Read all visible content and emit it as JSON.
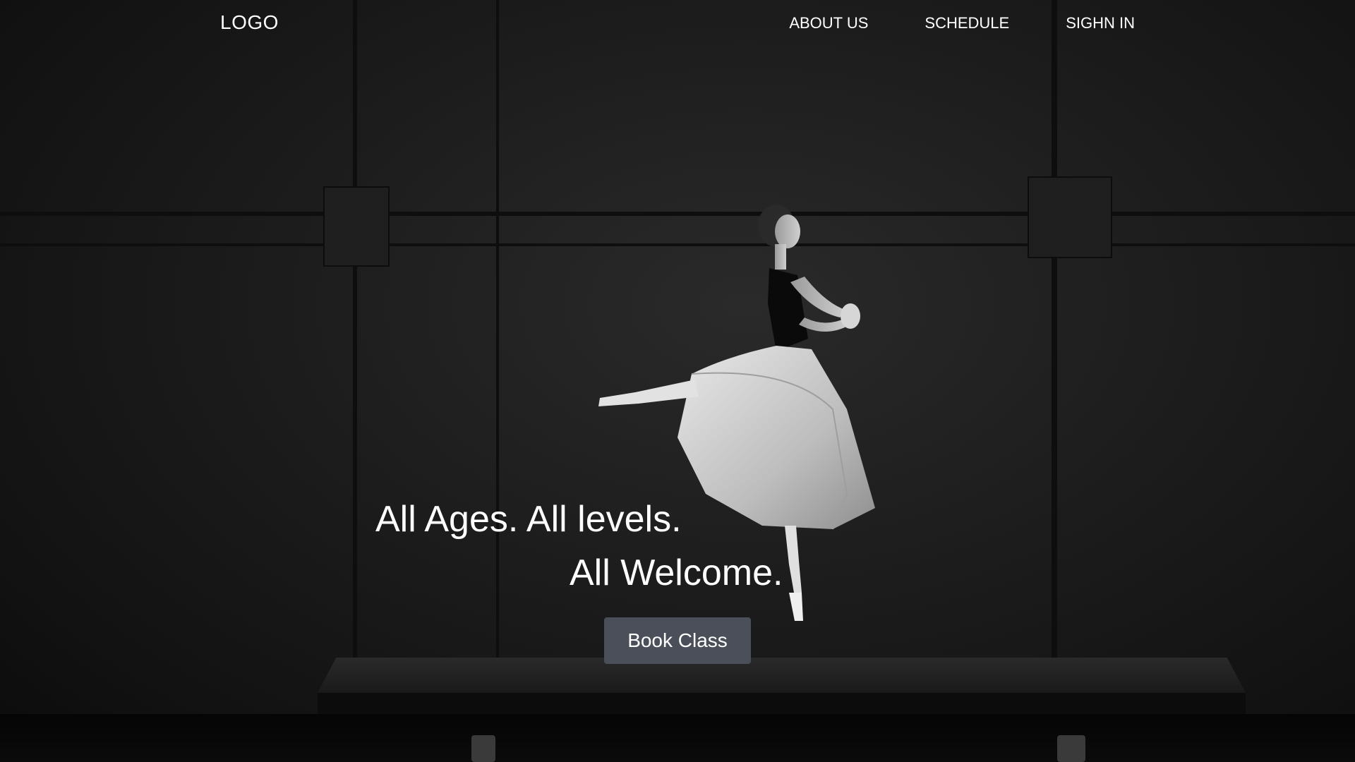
{
  "nav": {
    "logo": "LOGO",
    "links": [
      "ABOUT US",
      "SCHEDULE",
      "SIGHN IN"
    ]
  },
  "hero": {
    "headline_line1": "All Ages. All levels.",
    "headline_line2": "All Welcome.",
    "cta_label": "Book Class",
    "cta_color": "#4a4f59",
    "background_image": "ballerina-on-stage-photo"
  }
}
